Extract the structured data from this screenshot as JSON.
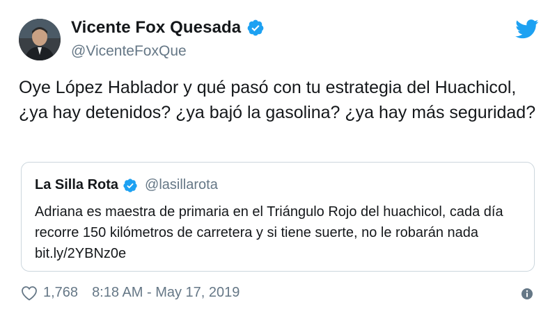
{
  "tweet": {
    "author": {
      "name": "Vicente Fox Quesada",
      "handle": "@VicenteFoxQue",
      "verified": true,
      "avatar_icon": "avatar-photo"
    },
    "text": "Oye López Hablador y qué pasó con tu estrategia del Huachicol, ¿ya hay detenidos? ¿ya bajó la gasolina? ¿ya hay más seguridad?",
    "quoted": {
      "name": "La Silla Rota",
      "handle": "@lasillarota",
      "verified": true,
      "text": "Adriana es maestra de primaria en el Triángulo Rojo del huachicol, cada día recorre 150 kilómetros de carretera y si tiene suerte, no le robarán nada bit.ly/2YBNz0e"
    },
    "likes": "1,768",
    "timestamp": "8:18 AM - May 17, 2019"
  },
  "colors": {
    "twitter_blue": "#1da1f2",
    "text": "#14171a",
    "secondary_text": "#657786",
    "border": "#ccd6dd"
  },
  "icons": {
    "brand": "twitter-bird-icon",
    "verified": "verified-badge-icon",
    "like": "heart-outline-icon",
    "info": "info-circle-icon"
  }
}
